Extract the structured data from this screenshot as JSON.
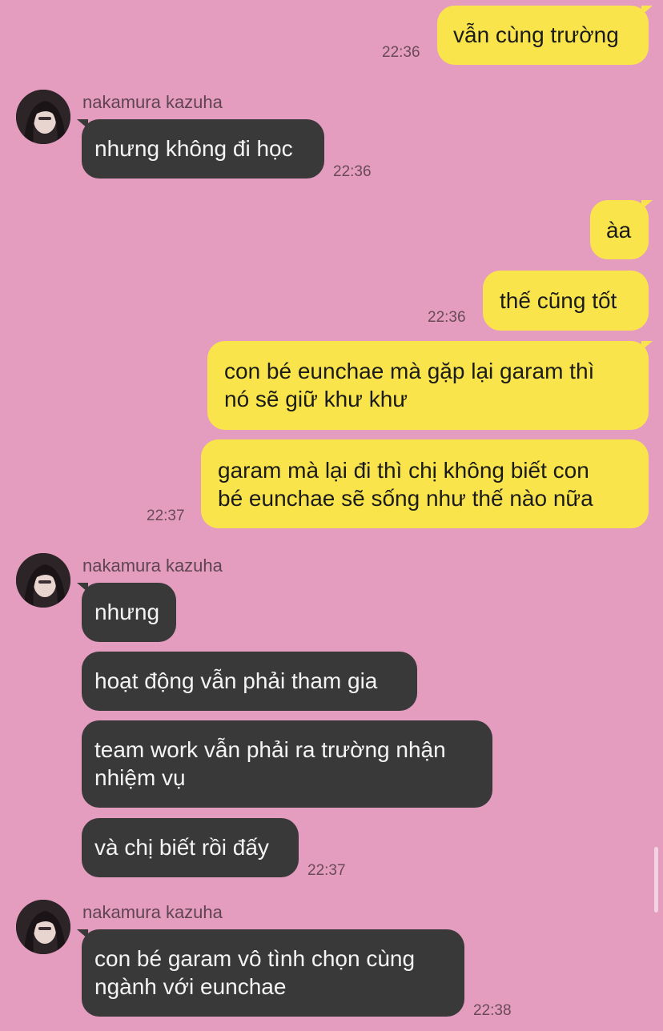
{
  "contact": {
    "name": "nakamura kazuha",
    "avatar_icon": "profile-photo"
  },
  "messages": {
    "m1": "vẫn cùng trường",
    "t1": "22:36",
    "m2": "nhưng không đi học",
    "t2": "22:36",
    "m3": "àa",
    "m4": "thế cũng tốt",
    "t4": "22:36",
    "m5": "con bé eunchae mà gặp lại garam thì\nnó sẽ giữ khư khư",
    "m6": "garam mà lại đi thì chị không biết con\nbé eunchae sẽ sống như thế nào nữa",
    "t6": "22:37",
    "m7": "nhưng",
    "m8": "hoạt động vẫn phải tham gia",
    "m9": "team work vẫn phải ra trường nhận\nnhiệm vụ",
    "m10": "và chị biết rồi đấy",
    "t10": "22:37",
    "m11": "con bé garam vô tình chọn cùng\nngành với eunchae",
    "t11": "22:38"
  },
  "colors": {
    "background": "#e49dbf",
    "outgoing_bubble": "#f9e54b",
    "incoming_bubble": "#393939"
  }
}
